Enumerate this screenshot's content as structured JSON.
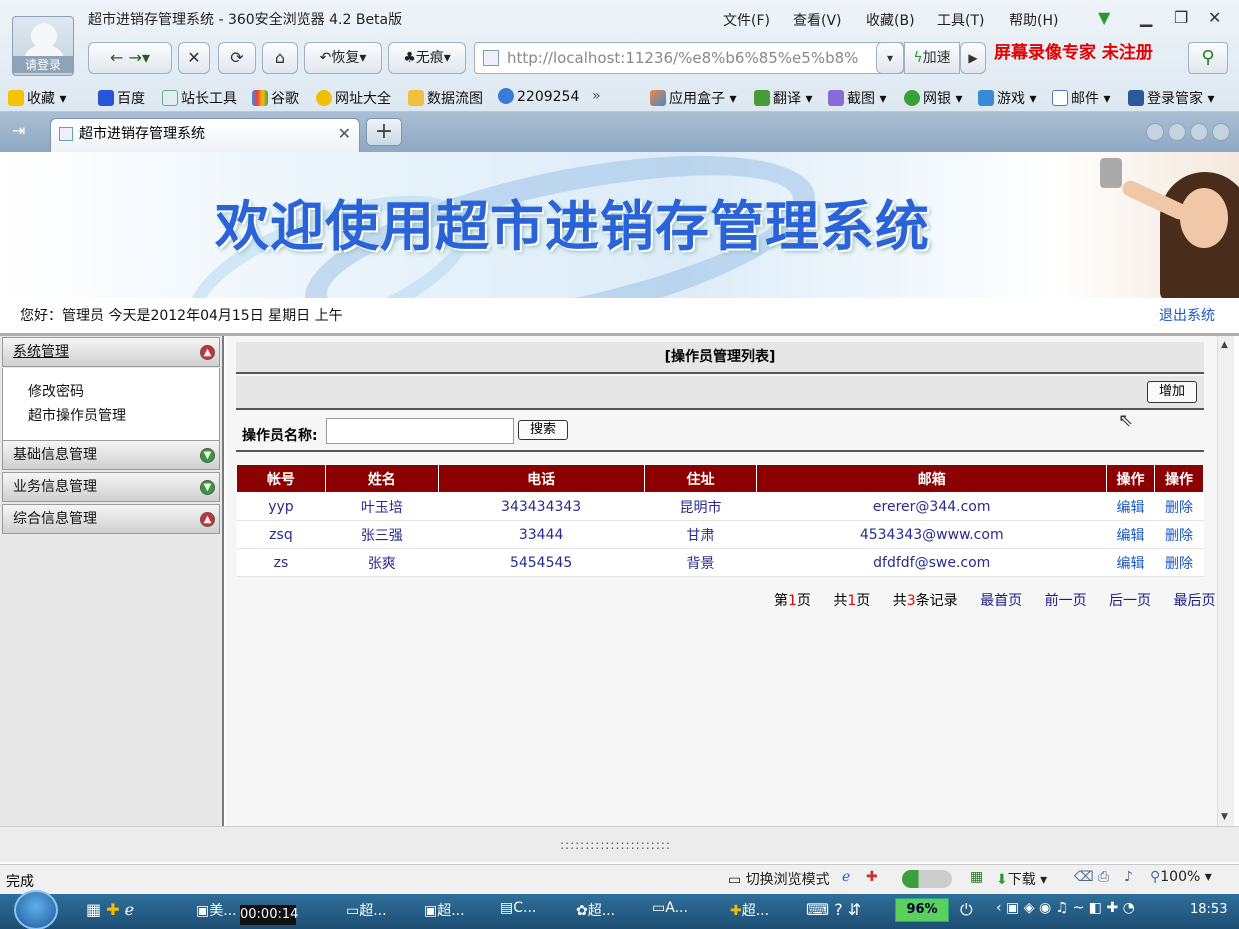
{
  "browser": {
    "window_title": "超市进销存管理系统 - 360安全浏览器 4.2 Beta版",
    "login_label": "请登录",
    "menus": [
      "文件(F)",
      "查看(V)",
      "收藏(B)",
      "工具(T)",
      "帮助(H)"
    ],
    "restore_label": "恢复",
    "incognito_label": "无痕",
    "address": "http://localhost:11236/%e8%b6%85%e5%b8%",
    "speed_label": "加速",
    "recorder_text": "屏幕录像专家  未注册",
    "favorites": [
      "收藏",
      "百度",
      "站长工具",
      "谷歌",
      "网址大全",
      "数据流图",
      "2209254",
      "»",
      "应用盒子",
      "翻译",
      "截图",
      "网银",
      "游戏",
      "邮件",
      "登录管家"
    ],
    "tab_title": "超市进销存管理系统"
  },
  "banner": {
    "title": "欢迎使用超市进销存管理系统"
  },
  "header": {
    "welcome": "您好：管理员    今天是2012年04月15日    星期日    上午",
    "logout": "退出系统"
  },
  "sidebar": {
    "sections": [
      "系统管理",
      "基础信息管理",
      "业务信息管理",
      "综合信息管理"
    ],
    "sub_items": [
      "修改密码",
      "超市操作员管理"
    ]
  },
  "main": {
    "list_title": "[操作员管理列表]",
    "add_button": "增加",
    "filter_label": "操作员名称:",
    "filter_value": "",
    "search_button": "搜索",
    "columns": [
      "帐号",
      "姓名",
      "电话",
      "住址",
      "邮箱",
      "操作",
      "操作"
    ],
    "rows": [
      {
        "account": "yyp",
        "name": "叶玉培",
        "phone": "343434343",
        "address": "昆明市",
        "email": "ererer@344.com",
        "edit": "编辑",
        "delete": "删除"
      },
      {
        "account": "zsq",
        "name": "张三强",
        "phone": "33444",
        "address": "甘肃",
        "email": "4534343@www.com",
        "edit": "编辑",
        "delete": "删除"
      },
      {
        "account": "zs",
        "name": "张爽",
        "phone": "5454545",
        "address": "背景",
        "email": "dfdfdf@swe.com",
        "edit": "编辑",
        "delete": "删除"
      }
    ],
    "pager": {
      "page_prefix": "第",
      "page": "1",
      "page_suffix": "页",
      "total_prefix": "共",
      "total_pages": "1",
      "total_suffix": "页",
      "rec_prefix": "共",
      "records": "3",
      "rec_suffix": "条记录",
      "first": "最首页",
      "prev": "前一页",
      "next": "后一页",
      "last": "最后页"
    }
  },
  "status": {
    "text": "完成",
    "mode": "切换浏览模式",
    "download": "下载",
    "zoom": "100%"
  },
  "taskbar": {
    "timer": "00:00:14",
    "tasks": [
      "美...",
      "超...",
      "超...",
      "C...",
      "超...",
      "A...",
      "超..."
    ],
    "battery": "96%",
    "clock": "18:53"
  }
}
